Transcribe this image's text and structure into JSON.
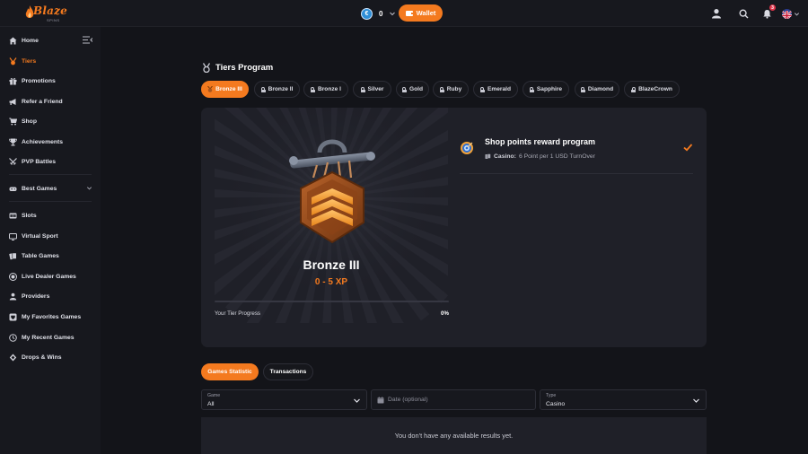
{
  "header": {
    "logo_text": "Blaze",
    "logo_sub": "SPINS",
    "balance": "0",
    "wallet_label": "Wallet",
    "notification_count": "3"
  },
  "sidebar": {
    "items": [
      {
        "label": "Home",
        "icon": "home-icon"
      },
      {
        "label": "Tiers",
        "icon": "medal-icon",
        "active": true
      },
      {
        "label": "Promotions",
        "icon": "gift-icon"
      },
      {
        "label": "Refer a Friend",
        "icon": "megaphone-icon"
      },
      {
        "label": "Shop",
        "icon": "cart-icon"
      },
      {
        "label": "Achievements",
        "icon": "trophy-icon"
      },
      {
        "label": "PVP Battles",
        "icon": "swords-icon"
      },
      {
        "label": "Best Games",
        "icon": "gamepad-icon"
      },
      {
        "label": "Slots",
        "icon": "slots-icon"
      },
      {
        "label": "Virtual Sport",
        "icon": "tv-icon"
      },
      {
        "label": "Table Games",
        "icon": "cards-icon"
      },
      {
        "label": "Live Dealer Games",
        "icon": "chip-icon"
      },
      {
        "label": "Providers",
        "icon": "providers-icon"
      },
      {
        "label": "My Favorites Games",
        "icon": "heart-icon"
      },
      {
        "label": "My Recent Games",
        "icon": "clock-icon"
      },
      {
        "label": "Drops & Wins",
        "icon": "drops-icon"
      }
    ]
  },
  "main": {
    "title": "Tiers Program",
    "tiers": [
      {
        "label": "Bronze III",
        "active": true
      },
      {
        "label": "Bronze II"
      },
      {
        "label": "Bronze I"
      },
      {
        "label": "Silver"
      },
      {
        "label": "Gold"
      },
      {
        "label": "Ruby"
      },
      {
        "label": "Emerald"
      },
      {
        "label": "Sapphire"
      },
      {
        "label": "Diamond"
      },
      {
        "label": "BlazeCrown"
      }
    ],
    "tier_card": {
      "name": "Bronze III",
      "xp_range": "0 - 5 XP",
      "progress_label": "Your Tier Progress",
      "progress_percent": "0%",
      "progress_value": 0
    },
    "reward": {
      "title": "Shop points reward program",
      "category": "Casino:",
      "detail": "6 Point per 1 USD TurnOver"
    },
    "stat_tabs": [
      {
        "label": "Games Statistic",
        "active": true
      },
      {
        "label": "Transactions"
      }
    ],
    "filters": {
      "game_label": "Game",
      "game_value": "All",
      "date_placeholder": "Date (optional)",
      "type_label": "Type",
      "type_value": "Casino"
    },
    "empty_message": "You don't have any available results yet."
  },
  "colors": {
    "accent": "#f47a1f",
    "background": "#131419",
    "card": "#1f2028"
  }
}
